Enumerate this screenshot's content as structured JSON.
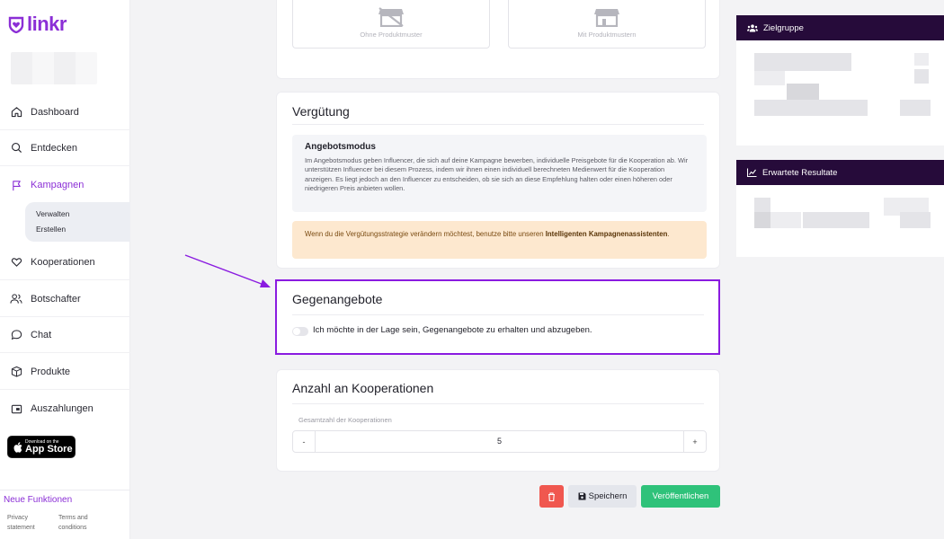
{
  "sidebar": {
    "logo_text": "linkr",
    "nav": [
      {
        "label": "Dashboard",
        "icon": "home-icon"
      },
      {
        "label": "Entdecken",
        "icon": "search-icon"
      },
      {
        "label": "Kampagnen",
        "icon": "flag-icon",
        "active": true
      },
      {
        "label": "Kooperationen",
        "icon": "heart-icon"
      },
      {
        "label": "Botschafter",
        "icon": "users-icon"
      },
      {
        "label": "Chat",
        "icon": "chat-icon"
      },
      {
        "label": "Produkte",
        "icon": "box-icon"
      },
      {
        "label": "Auszahlungen",
        "icon": "wallet-icon"
      }
    ],
    "subnav": [
      "Verwalten",
      "Erstellen"
    ],
    "appstore": {
      "small": "Download on the",
      "big": "App Store"
    },
    "neue_funktionen": "Neue Funktionen",
    "privacy": "Privacy statement",
    "privacy_l1": "Privacy",
    "privacy_l2": "statement",
    "terms_l1": "Terms and",
    "terms_l2": "conditions"
  },
  "produkt": {
    "ohne_label": "Ohne Produktmuster",
    "mit_label": "Mit Produktmustern"
  },
  "verguetung": {
    "title": "Vergütung",
    "info_title": "Angebotsmodus",
    "info_text": "Im Angebotsmodus geben Influencer, die sich auf deine Kampagne bewerben, individuelle Preisgebote für die Kooperation ab. Wir unterstützen Influencer bei diesem Prozess, indem wir ihnen einen individuell berechneten Medienwert für die Kooperation anzeigen. Es liegt jedoch an den Influencer zu entscheiden, ob sie sich an diese Empfehlung halten oder einen höheren oder niedrigeren Preis anbieten wollen.",
    "warn_text": "Wenn du die Vergütungsstrategie verändern möchtest, benutze bitte unseren ",
    "warn_link": "Intelligenten Kampagnenassistenten",
    "warn_end": "."
  },
  "gegenangebote": {
    "title": "Gegenangebote",
    "toggle_label": "Ich möchte in der Lage sein, Gegenangebote zu erhalten und abzugeben.",
    "toggle_on": false
  },
  "anzahl": {
    "title": "Anzahl an Kooperationen",
    "field_label": "Gesamtzahl der Kooperationen",
    "minus": "-",
    "value": "5",
    "plus": "+"
  },
  "actions": {
    "delete_icon": "trash-icon",
    "save_label": "Speichern",
    "publish_label": "Veröffentlichen"
  },
  "right": {
    "zielgruppe": "Zielgruppe",
    "resultate": "Erwartete Resultate"
  },
  "colors": {
    "brand": "#8b2fd6",
    "highlight": "#8a1be0",
    "panel_head": "#260b3a",
    "delete": "#f0574f",
    "publish": "#2fc27a",
    "save": "#e4e6ec"
  }
}
